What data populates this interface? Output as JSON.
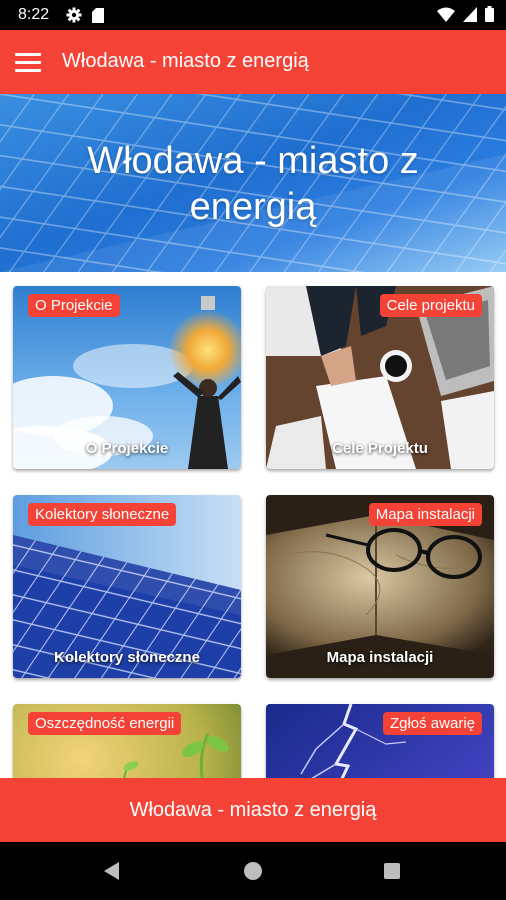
{
  "status_bar": {
    "time": "8:22",
    "icons_left": [
      "gear-icon",
      "sd-card-icon"
    ],
    "icons_right": [
      "wifi-icon",
      "signal-icon",
      "battery-icon"
    ]
  },
  "app_bar": {
    "menu_icon": "hamburger-menu-icon",
    "title": "Włodawa - miasto z energią"
  },
  "hero": {
    "title_line1": "Włodawa - miasto z",
    "title_line2": "energią"
  },
  "cards": [
    {
      "badge": "O Projekcie",
      "caption": "O Projekcie"
    },
    {
      "badge": "Cele projektu",
      "caption": "Cele Projektu"
    },
    {
      "badge": "Kolektory słoneczne",
      "caption": "Kolektory słoneczne"
    },
    {
      "badge": "Mapa instalacji",
      "caption": "Mapa instalacji"
    },
    {
      "badge": "Oszczędność energii",
      "caption": ""
    },
    {
      "badge": "Zgłoś awarię",
      "caption": ""
    }
  ],
  "bottom_banner": {
    "text": "Włodawa - miasto z energią"
  },
  "nav_bar": {
    "icons": [
      "back-icon",
      "home-icon",
      "recents-icon"
    ]
  },
  "colors": {
    "primary": "#f44336",
    "status_bar": "#000000"
  }
}
